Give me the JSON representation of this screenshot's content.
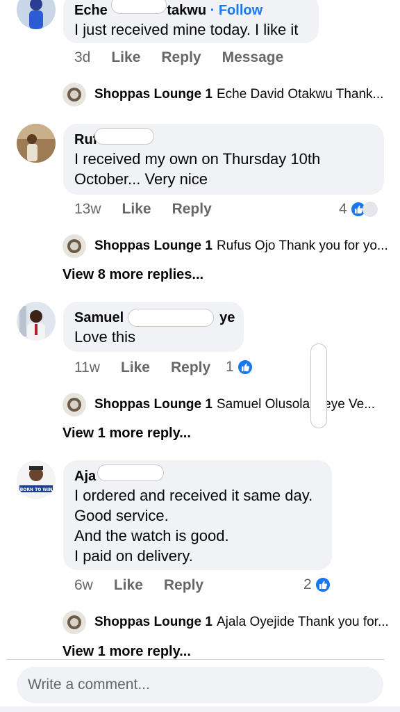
{
  "comments": [
    {
      "name": "Eche",
      "name_tail": "takwu",
      "follow": "· Follow",
      "text": "I just received mine today. I like it",
      "time": "3d",
      "like": "Like",
      "reply": "Reply",
      "message": "Message",
      "reply_preview": {
        "name": "Shoppas Lounge 1",
        "text": "Eche David Otakwu Thank..."
      }
    },
    {
      "name": "Ruf",
      "text_lines": [
        "I received my own on Thursday 10th",
        "October... Very nice"
      ],
      "time": "13w",
      "like": "Like",
      "reply": "Reply",
      "reaction_count": "4",
      "reply_preview": {
        "name": "Shoppas Lounge 1",
        "text": "Rufus Ojo Thank you for yo..."
      },
      "more": "View 8 more replies..."
    },
    {
      "name": "Samuel C",
      "name_tail": "ye",
      "text": "Love this",
      "time": "11w",
      "like": "Like",
      "reply": "Reply",
      "reaction_count": "1",
      "reply_preview": {
        "name": "Shoppas Lounge 1",
        "text": "Samuel Olusola    aleye Ve..."
      },
      "more": "View 1 more reply..."
    },
    {
      "name": "Aja",
      "text_lines": [
        "I ordered and received it same day.",
        "Good service.",
        "And the watch is good.",
        "I paid on delivery."
      ],
      "time": "6w",
      "like": "Like",
      "reply": "Reply",
      "reaction_count": "2",
      "reply_preview": {
        "name": "Shoppas Lounge 1",
        "text": "Ajala Oyejide Thank you for..."
      },
      "more": "View 1 more reply..."
    }
  ],
  "composer": {
    "placeholder": "Write a comment..."
  },
  "avatar_badge_text": "BORN TO WIN",
  "colors": {
    "accent": "#1877f2",
    "bubble": "#f0f2f5",
    "muted": "#65676b"
  }
}
